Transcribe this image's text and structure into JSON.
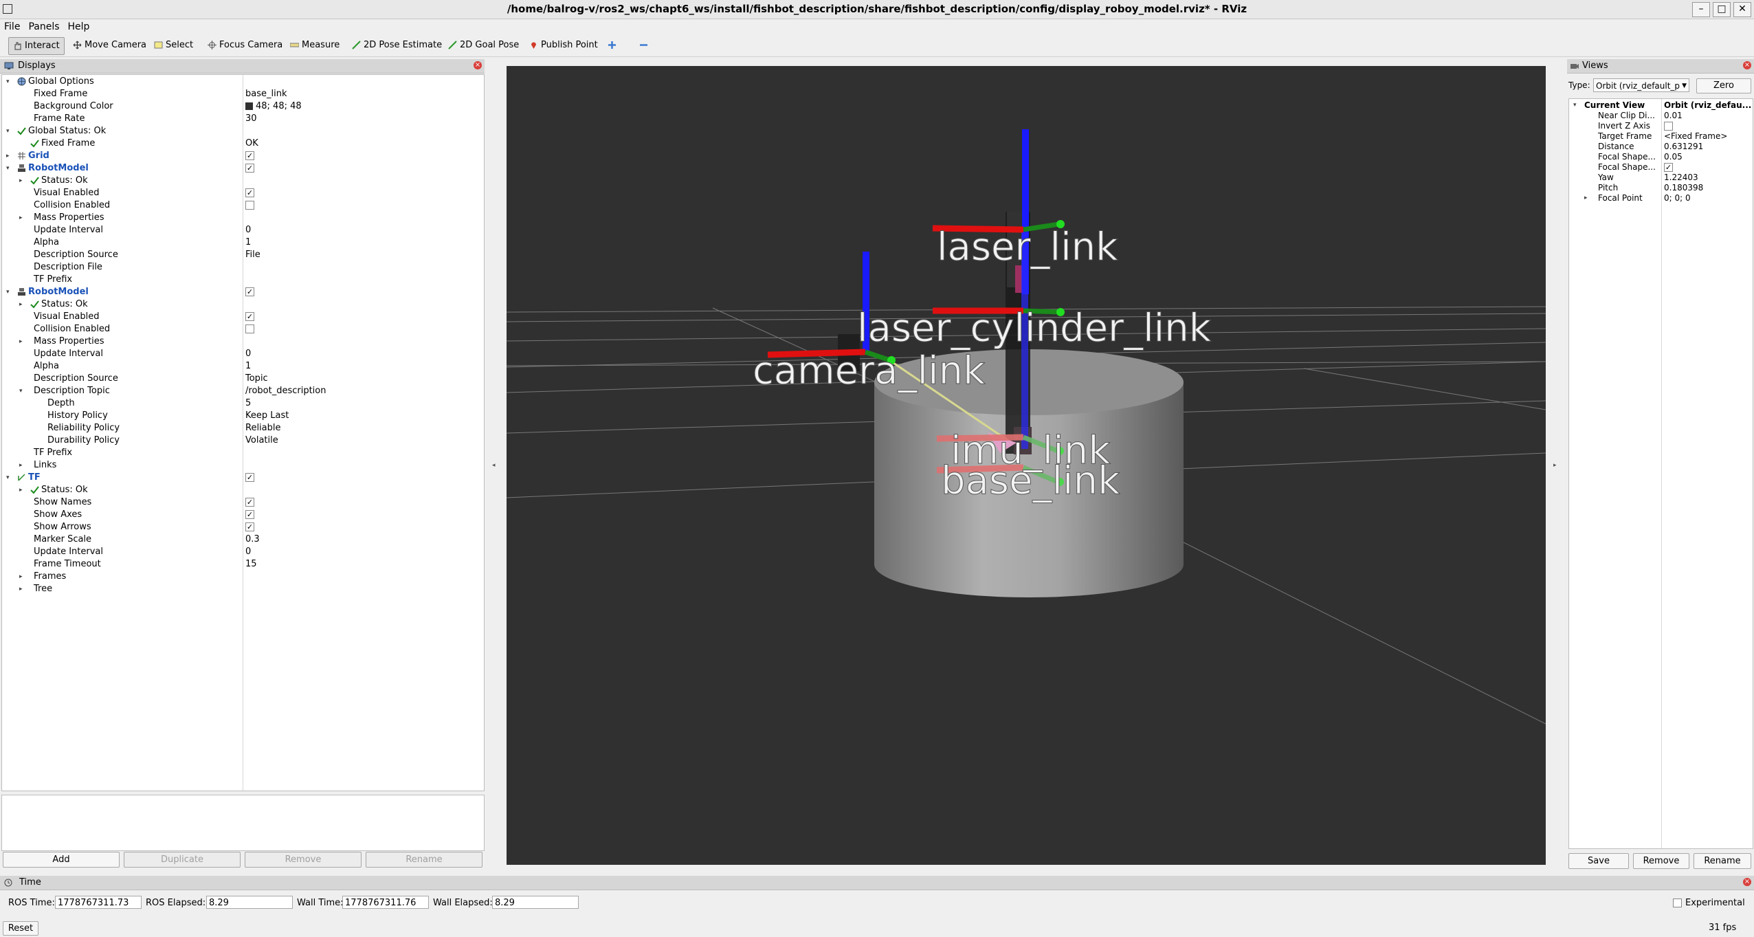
{
  "window": {
    "title": "/home/balrog-v/ros2_ws/chapt6_ws/install/fishbot_description/share/fishbot_description/config/display_roboy_model.rviz* - RViz",
    "minimize": "–",
    "maximize": "□",
    "close": "✕"
  },
  "menu": {
    "file": "File",
    "panels": "Panels",
    "help": "Help"
  },
  "toolbar": {
    "interact": "Interact",
    "move_camera": "Move Camera",
    "select": "Select",
    "focus_camera": "Focus Camera",
    "measure": "Measure",
    "pose_estimate": "2D Pose Estimate",
    "goal_pose": "2D Goal Pose",
    "publish_point": "Publish Point"
  },
  "displays": {
    "header": "Displays",
    "rows": [
      {
        "indent": 0,
        "arrow": "down",
        "icon": "globe",
        "label": "Global Options",
        "value": ""
      },
      {
        "indent": 1,
        "label": "Fixed Frame",
        "value": "base_link"
      },
      {
        "indent": 1,
        "label": "Background Color",
        "value": "48; 48; 48",
        "swatch": true
      },
      {
        "indent": 1,
        "label": "Frame Rate",
        "value": "30"
      },
      {
        "indent": 0,
        "arrow": "down",
        "icon": "check",
        "label": "Global Status: Ok",
        "value": ""
      },
      {
        "indent": 1,
        "icon": "check",
        "label": "Fixed Frame",
        "value": "OK"
      },
      {
        "indent": 0,
        "arrow": "right",
        "icon": "grid",
        "label": "Grid",
        "value": "",
        "check": true,
        "blue": true
      },
      {
        "indent": 0,
        "arrow": "down",
        "icon": "robot",
        "label": "RobotModel",
        "value": "",
        "check": true,
        "blue": true
      },
      {
        "indent": 1,
        "arrow": "right",
        "icon": "check",
        "label": "Status: Ok",
        "value": ""
      },
      {
        "indent": 1,
        "label": "Visual Enabled",
        "value": "",
        "check": true
      },
      {
        "indent": 1,
        "label": "Collision Enabled",
        "value": "",
        "check": false
      },
      {
        "indent": 1,
        "arrow": "right",
        "label": "Mass Properties",
        "value": ""
      },
      {
        "indent": 1,
        "label": "Update Interval",
        "value": "0"
      },
      {
        "indent": 1,
        "label": "Alpha",
        "value": "1"
      },
      {
        "indent": 1,
        "label": "Description Source",
        "value": "File"
      },
      {
        "indent": 1,
        "label": "Description File",
        "value": ""
      },
      {
        "indent": 1,
        "label": "TF Prefix",
        "value": ""
      },
      {
        "indent": 0,
        "arrow": "down",
        "icon": "robot",
        "label": "RobotModel",
        "value": "",
        "check": true,
        "blue": true
      },
      {
        "indent": 1,
        "arrow": "right",
        "icon": "check",
        "label": "Status: Ok",
        "value": ""
      },
      {
        "indent": 1,
        "label": "Visual Enabled",
        "value": "",
        "check": true
      },
      {
        "indent": 1,
        "label": "Collision Enabled",
        "value": "",
        "check": false
      },
      {
        "indent": 1,
        "arrow": "right",
        "label": "Mass Properties",
        "value": ""
      },
      {
        "indent": 1,
        "label": "Update Interval",
        "value": "0"
      },
      {
        "indent": 1,
        "label": "Alpha",
        "value": "1"
      },
      {
        "indent": 1,
        "label": "Description Source",
        "value": "Topic"
      },
      {
        "indent": 1,
        "arrow": "down",
        "label": "Description Topic",
        "value": "/robot_description"
      },
      {
        "indent": 2,
        "label": "Depth",
        "value": "5"
      },
      {
        "indent": 2,
        "label": "History Policy",
        "value": "Keep Last"
      },
      {
        "indent": 2,
        "label": "Reliability Policy",
        "value": "Reliable"
      },
      {
        "indent": 2,
        "label": "Durability Policy",
        "value": "Volatile"
      },
      {
        "indent": 1,
        "label": "TF Prefix",
        "value": ""
      },
      {
        "indent": 1,
        "arrow": "right",
        "label": "Links",
        "value": ""
      },
      {
        "indent": 0,
        "arrow": "down",
        "icon": "tf",
        "label": "TF",
        "value": "",
        "check": true,
        "blue": true
      },
      {
        "indent": 1,
        "arrow": "right",
        "icon": "check",
        "label": "Status: Ok",
        "value": ""
      },
      {
        "indent": 1,
        "label": "Show Names",
        "value": "",
        "check": true
      },
      {
        "indent": 1,
        "label": "Show Axes",
        "value": "",
        "check": true
      },
      {
        "indent": 1,
        "label": "Show Arrows",
        "value": "",
        "check": true
      },
      {
        "indent": 1,
        "label": "Marker Scale",
        "value": "0.3"
      },
      {
        "indent": 1,
        "label": "Update Interval",
        "value": "0"
      },
      {
        "indent": 1,
        "label": "Frame Timeout",
        "value": "15"
      },
      {
        "indent": 1,
        "arrow": "right",
        "label": "Frames",
        "value": ""
      },
      {
        "indent": 1,
        "arrow": "right",
        "label": "Tree",
        "value": ""
      }
    ],
    "buttons": {
      "add": "Add",
      "duplicate": "Duplicate",
      "remove": "Remove",
      "rename": "Rename"
    }
  },
  "viewport": {
    "background": "#303030",
    "frame_labels": {
      "laser_link": "laser_link",
      "laser_cylinder_link": "laser_cylinder_link",
      "camera_link": "camera_link",
      "imu_link": "imu_link",
      "base_link": "base_link"
    }
  },
  "views": {
    "header": "Views",
    "type_label": "Type:",
    "type_value": "Orbit (rviz_default_p",
    "zero": "Zero",
    "rows": [
      {
        "indent": 0,
        "arrow": "down",
        "label": "Current View",
        "value": "Orbit (rviz_defau...",
        "bold": true
      },
      {
        "indent": 1,
        "label": "Near Clip Di...",
        "value": "0.01"
      },
      {
        "indent": 1,
        "label": "Invert Z Axis",
        "value": "",
        "check": false
      },
      {
        "indent": 1,
        "label": "Target Frame",
        "value": "<Fixed Frame>"
      },
      {
        "indent": 1,
        "label": "Distance",
        "value": "0.631291"
      },
      {
        "indent": 1,
        "label": "Focal Shape...",
        "value": "0.05"
      },
      {
        "indent": 1,
        "label": "Focal Shape...",
        "value": "",
        "check": true
      },
      {
        "indent": 1,
        "label": "Yaw",
        "value": "1.22403"
      },
      {
        "indent": 1,
        "label": "Pitch",
        "value": "0.180398"
      },
      {
        "indent": 1,
        "arrow": "right",
        "label": "Focal Point",
        "value": "0; 0; 0"
      }
    ],
    "buttons": {
      "save": "Save",
      "remove": "Remove",
      "rename": "Rename"
    }
  },
  "time": {
    "header": "Time",
    "ros_time_label": "ROS Time:",
    "ros_time": "1778767311.73",
    "ros_elapsed_label": "ROS Elapsed:",
    "ros_elapsed": "8.29",
    "wall_time_label": "Wall Time:",
    "wall_time": "1778767311.76",
    "wall_elapsed_label": "Wall Elapsed:",
    "wall_elapsed": "8.29",
    "experimental": "Experimental",
    "reset": "Reset",
    "fps": "31 fps"
  }
}
